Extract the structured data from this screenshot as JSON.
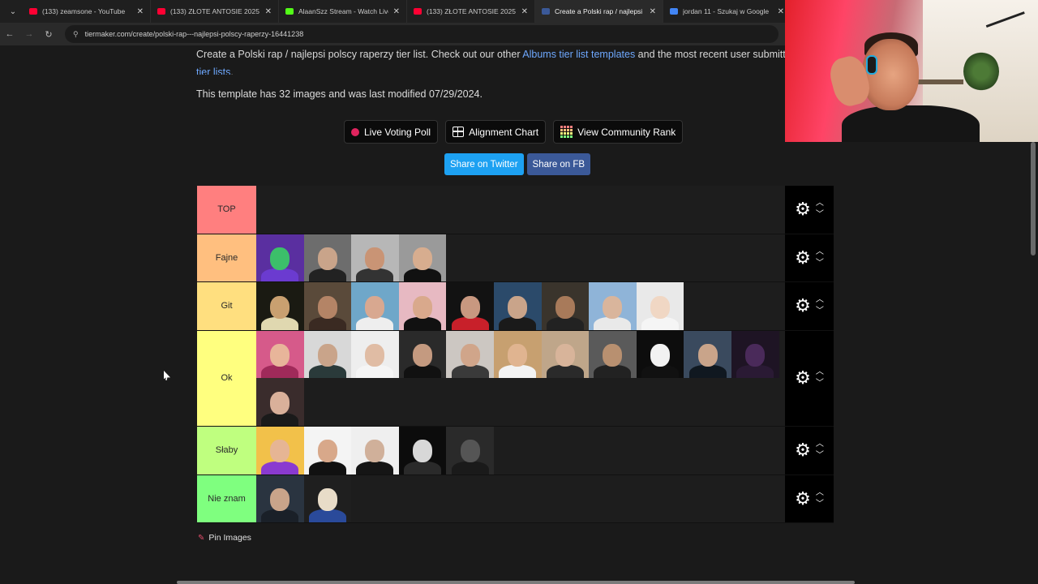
{
  "browser": {
    "tabs": [
      {
        "title": "(133) zeamsone - YouTube",
        "favicon_color": "#ff0033",
        "active": false
      },
      {
        "title": "(133) ZŁOTE ANTOSIE 2025 NA",
        "favicon_color": "#ff0033",
        "active": false
      },
      {
        "title": "AlaanSzz Stream - Watch Live o",
        "favicon_color": "#53fc18",
        "active": false
      },
      {
        "title": "(133) ZŁOTE ANTOSIE 2025 | D",
        "favicon_color": "#ff0033",
        "active": false
      },
      {
        "title": "Create a Polski rap / najlepsi p",
        "favicon_color": "#3b5998",
        "active": true
      },
      {
        "title": "jordan 11 - Szukaj w Google",
        "favicon_color": "#4285f4",
        "active": false
      }
    ],
    "url": "tiermaker.com/create/polski-rap---najlepsi-polscy-raperzy-16441238"
  },
  "page": {
    "intro_text": "Create a Polski rap / najlepsi polscy raperzy tier list. Check out our other ",
    "intro_link1": "Albums tier list templates",
    "intro_mid": " and the most recent user submitt",
    "intro_link2": "tier lists",
    "intro_end": ".",
    "template_info": "This template has 32 images and was last modified 07/29/2024.",
    "buttons": {
      "live_voting": "Live Voting Poll",
      "alignment": "Alignment Chart",
      "community_rank": "View Community Rank"
    },
    "share": {
      "twitter": "Share on Twitter",
      "fb": "Share on FB",
      "twitter_color": "#1da1f2",
      "fb_color": "#3b5998"
    },
    "pin_label": "Pin Images"
  },
  "tiers": [
    {
      "label": "TOP",
      "color": "#ff7f7f",
      "items": []
    },
    {
      "label": "Fajne",
      "color": "#ffbf7f",
      "items": [
        {
          "bg": "#5a2fa0",
          "skin": "#3cbf6a",
          "cloth": "#6b3bd0"
        },
        {
          "bg": "#6d6d6d",
          "skin": "#c9a48a",
          "cloth": "#222"
        },
        {
          "bg": "#b7b7b7",
          "skin": "#c99475",
          "cloth": "#333"
        },
        {
          "bg": "#9a9a9a",
          "skin": "#d7ad8f",
          "cloth": "#111"
        }
      ]
    },
    {
      "label": "Git",
      "color": "#ffdf7f",
      "items": [
        {
          "bg": "#1a1a12",
          "skin": "#c9a070",
          "cloth": "#e0d8b0"
        },
        {
          "bg": "#5a4a3a",
          "skin": "#b48466",
          "cloth": "#3a2a22"
        },
        {
          "bg": "#6fa7c9",
          "skin": "#d8a890",
          "cloth": "#eee"
        },
        {
          "bg": "#e7b9c2",
          "skin": "#d9a98c",
          "cloth": "#111"
        },
        {
          "bg": "#121212",
          "skin": "#c89880",
          "cloth": "#c8202a"
        },
        {
          "bg": "#2b4a6a",
          "skin": "#c9a48a",
          "cloth": "#1a1a1a"
        },
        {
          "bg": "#3a342c",
          "skin": "#a87a5a",
          "cloth": "#222"
        },
        {
          "bg": "#8fb4d8",
          "skin": "#d9b59c",
          "cloth": "#e9e9e9"
        },
        {
          "bg": "#e9e9e9",
          "skin": "#f0d7c4",
          "cloth": "#f5f5f5"
        }
      ]
    },
    {
      "label": "Ok",
      "color": "#ffff7f",
      "items": [
        {
          "bg": "#d65a8a",
          "skin": "#e8b59a",
          "cloth": "#a02a5a"
        },
        {
          "bg": "#d8d8d8",
          "skin": "#c9a48a",
          "cloth": "#2a3a3a"
        },
        {
          "bg": "#eeeeee",
          "skin": "#e0bca4",
          "cloth": "#f5f5f5"
        },
        {
          "bg": "#2a2a2a",
          "skin": "#c49a80",
          "cloth": "#111"
        },
        {
          "bg": "#ccc7c2",
          "skin": "#d0a58a",
          "cloth": "#3a3a3a"
        },
        {
          "bg": "#c7a070",
          "skin": "#e0b490",
          "cloth": "#f3f3f3"
        },
        {
          "bg": "#bfa68a",
          "skin": "#d8b49a",
          "cloth": "#2a2a2a"
        },
        {
          "bg": "#5a5a5a",
          "skin": "#b89070",
          "cloth": "#222"
        },
        {
          "bg": "#0d0d0d",
          "skin": "#f2f2f2",
          "cloth": "#111"
        },
        {
          "bg": "#3a4a5e",
          "skin": "#c9a48a",
          "cloth": "#101820"
        },
        {
          "bg": "#1e1424",
          "skin": "#4a2a5a",
          "cloth": "#2a1a34"
        },
        {
          "bg": "#3a2c2c",
          "skin": "#d9b09a",
          "cloth": "#1a1a1a"
        }
      ]
    },
    {
      "label": "Słaby",
      "color": "#bfff7f",
      "items": [
        {
          "bg": "#f2c14a",
          "skin": "#e6b594",
          "cloth": "#8a3ad0"
        },
        {
          "bg": "#f4f4f4",
          "skin": "#d8a88a",
          "cloth": "#111"
        },
        {
          "bg": "#efefef",
          "skin": "#d0b09a",
          "cloth": "#151515"
        },
        {
          "bg": "#0c0c0c",
          "skin": "#d8d8d8",
          "cloth": "#2a2a2a"
        },
        {
          "bg": "#2a2a2a",
          "skin": "#555",
          "cloth": "#1a1a1a"
        }
      ]
    },
    {
      "label": "Nie znam",
      "color": "#7fff7f",
      "items": [
        {
          "bg": "#2a3440",
          "skin": "#c9a48a",
          "cloth": "#1a2028"
        },
        {
          "bg": "#1f1f1f",
          "skin": "#e8dcc8",
          "cloth": "#2a4a9a"
        }
      ]
    }
  ],
  "icons": {
    "gear": "⚙",
    "up": "︿",
    "down": "﹀",
    "pin": "📌"
  }
}
